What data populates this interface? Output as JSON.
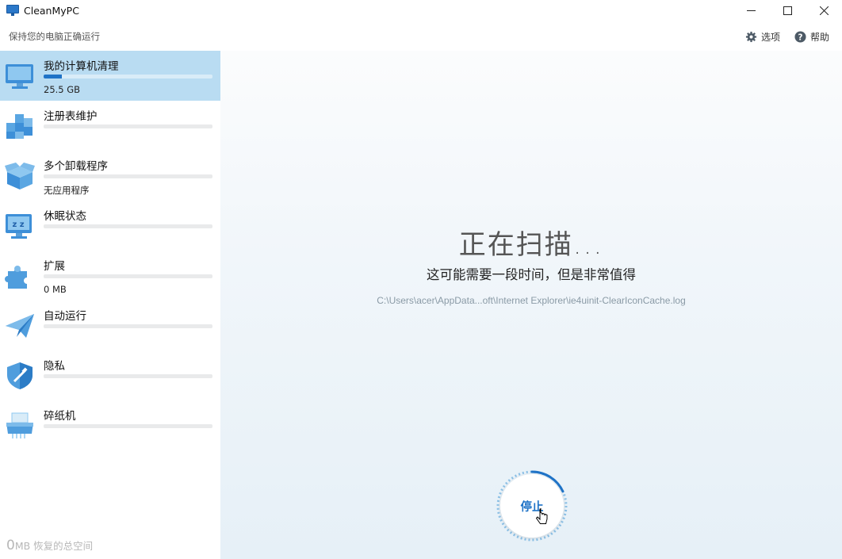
{
  "app": {
    "title": "CleanMyPC",
    "subtitle": "保持您的电脑正确运行"
  },
  "window_controls": {
    "minimize": "minimize-icon",
    "maximize": "maximize-icon",
    "close": "close-icon"
  },
  "top_actions": {
    "options_label": "选项",
    "help_label": "帮助"
  },
  "sidebar": {
    "items": [
      {
        "label": "我的计算机清理",
        "sub": "25.5 GB",
        "progress": 0.11,
        "icon": "monitor-icon",
        "active": true
      },
      {
        "label": "注册表维护",
        "sub": "",
        "progress": 0,
        "icon": "registry-cubes-icon",
        "active": false
      },
      {
        "label": "多个卸载程序",
        "sub": "无应用程序",
        "progress": 0,
        "icon": "box-icon",
        "active": false
      },
      {
        "label": "休眠状态",
        "sub": "",
        "progress": 0,
        "icon": "sleep-monitor-icon",
        "active": false
      },
      {
        "label": "扩展",
        "sub": "0 MB",
        "progress": 0,
        "icon": "puzzle-icon",
        "active": false
      },
      {
        "label": "自动运行",
        "sub": "",
        "progress": 0,
        "icon": "paper-plane-icon",
        "active": false
      },
      {
        "label": "隐私",
        "sub": "",
        "progress": 0,
        "icon": "shield-icon",
        "active": false
      },
      {
        "label": "碎纸机",
        "sub": "",
        "progress": 0,
        "icon": "shredder-icon",
        "active": false
      }
    ],
    "footer": {
      "value": "0",
      "unit_text": "MB 恢复的总空间"
    }
  },
  "main": {
    "title": "正在扫描...",
    "subtitle": "这可能需要一段时间，但是非常值得",
    "path": "C:\\Users\\acer\\AppData...oft\\Internet Explorer\\ie4uinit-ClearIconCache.log",
    "stop_label": "停止",
    "spinner_progress": 0.18
  },
  "colors": {
    "accent": "#1f73c7",
    "active_bg": "#b9dcf2"
  }
}
